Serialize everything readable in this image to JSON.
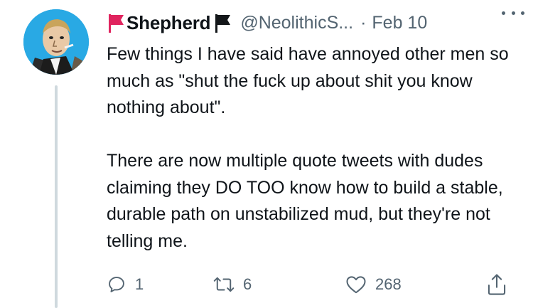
{
  "tweet": {
    "display_name": "Shepherd",
    "handle": "@NeolithicS...",
    "separator": "·",
    "date": "Feb 10",
    "body": "Few things I have said have annoyed other men so much as \"shut the fuck up about shit you know nothing about\".\n\nThere are now multiple quote tweets with dudes claiming they DO TOO know how to build a stable, durable path on unstabilized mud, but they're not telling me."
  },
  "icons": {
    "name_prefix": "red-flag-icon",
    "name_suffix": "black-flag-icon",
    "more": "more-options-icon",
    "reply": "reply-icon",
    "retweet": "retweet-icon",
    "like": "like-icon",
    "share": "share-icon"
  },
  "actions": {
    "replies": "1",
    "retweets": "6",
    "likes": "268"
  },
  "colors": {
    "secondary_text": "#536471",
    "flag_red": "#e0245e",
    "flag_black": "#14171a",
    "avatar_bg": "#29a9e4",
    "thread_line": "#cfd9de"
  }
}
